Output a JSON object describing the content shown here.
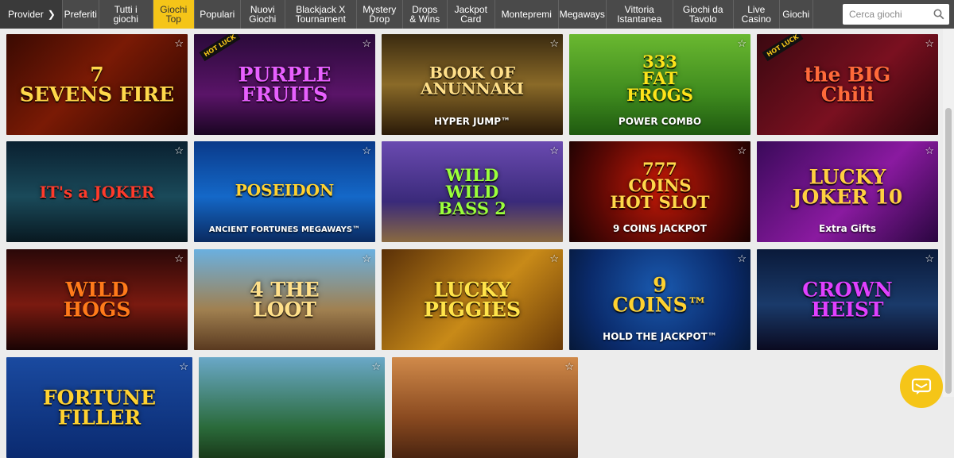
{
  "nav": {
    "provider": "Provider",
    "items": [
      {
        "label": "Preferiti"
      },
      {
        "label": "Tutti i\ngiochi"
      },
      {
        "label": "Giochi\nTop"
      },
      {
        "label": "Populari"
      },
      {
        "label": "Nuovi\nGiochi"
      },
      {
        "label": "Blackjack X\nTournament"
      },
      {
        "label": "Mystery\nDrop"
      },
      {
        "label": "Drops\n& Wins"
      },
      {
        "label": "Jackpot\nCard"
      },
      {
        "label": "Montepremi"
      },
      {
        "label": "Megaways"
      },
      {
        "label": "Vittoria\nIstantanea"
      },
      {
        "label": "Giochi da\nTavolo"
      },
      {
        "label": "Live\nCasino"
      },
      {
        "label": "Giochi"
      }
    ],
    "active_index": 2,
    "search_placeholder": "Cerca giochi"
  },
  "games": [
    {
      "title": "7\nSEVENS FIRE",
      "subtitle": "",
      "badge": "",
      "bg": "linear-gradient(135deg,#3a0a02,#7a1a05 45%,#2a0500)",
      "color": "#ffd84a"
    },
    {
      "title": "PURPLE\nFRUITS",
      "subtitle": "",
      "badge": "HOT LUCK",
      "bg": "linear-gradient(180deg,#2a0a3a,#5a1468 60%,#1a0522)",
      "color": "#e860ff"
    },
    {
      "title": "BOOK OF ANUNNAKI",
      "subtitle": "HYPER JUMP™",
      "badge": "",
      "bg": "linear-gradient(180deg,#3a2a10,#8a6a28 50%,#2a1a08)",
      "color": "#ffe08a"
    },
    {
      "title": "333\nFAT\nFROGS",
      "subtitle": "POWER COMBO",
      "badge": "",
      "bg": "linear-gradient(180deg,#6ab830,#3e8a1e 60%,#1f5a10)",
      "color": "#ffe31a"
    },
    {
      "title": "the BIG\nChili",
      "subtitle": "",
      "badge": "HOT LUCK",
      "bg": "linear-gradient(135deg,#3a0810,#7a1020 55%,#2a0408)",
      "color": "#ff6a3a"
    },
    {
      "title": "IT's a JOKER",
      "subtitle": "",
      "badge": "",
      "bg": "linear-gradient(180deg,#0a2030,#1a4a5a 55%,#081820)",
      "color": "#ff3a2a"
    },
    {
      "title": "POSEIDON",
      "subtitle": "ANCIENT FORTUNES MEGAWAYS™",
      "badge": "",
      "bg": "linear-gradient(180deg,#0a3a8a,#1468c8 55%,#0a2a60)",
      "color": "#ffd230"
    },
    {
      "title": "WILD\nWILD\nBASS 2",
      "subtitle": "",
      "badge": "",
      "bg": "linear-gradient(180deg,#6a4ab0,#3a2a7a 60%,#8a6a40)",
      "color": "#9aff3a"
    },
    {
      "title": "777\nCOINS\nHOT SLOT",
      "subtitle": "9 COINS JACKPOT",
      "badge": "",
      "bg": "radial-gradient(circle at 50% 45%,#c81a08,#5a0804 60%,#1a0202)",
      "color": "#ffd84a"
    },
    {
      "title": "LUCKY\nJOKER 10",
      "subtitle": "Extra Gifts",
      "badge": "",
      "bg": "linear-gradient(135deg,#3a0a5a,#8a1aa0 55%,#2a0640)",
      "color": "#ffd040"
    },
    {
      "title": "WILD\nHOGS",
      "subtitle": "",
      "badge": "",
      "bg": "linear-gradient(180deg,#2a0808,#7a1a10 55%,#1a0404)",
      "color": "#ff7a1a"
    },
    {
      "title": "4 THE\nLOOT",
      "subtitle": "",
      "badge": "",
      "bg": "linear-gradient(180deg,#6ab0e0,#a08050 60%,#5a3a20)",
      "color": "#ffe08a"
    },
    {
      "title": "LUCKY\nPIGGIES",
      "subtitle": "",
      "badge": "",
      "bg": "linear-gradient(135deg,#5a3008,#c88a18 55%,#6a3a08)",
      "color": "#ffe44a"
    },
    {
      "title": "9\nCOINS™",
      "subtitle": "HOLD THE JACKPOT™",
      "badge": "",
      "bg": "radial-gradient(circle at 50% 40%,#1a5ab0,#0a2a6a 65%,#061838)",
      "color": "#ffd230"
    },
    {
      "title": "CROWN\nHEIST",
      "subtitle": "",
      "badge": "",
      "bg": "linear-gradient(180deg,#0a1a3a,#1a3a6a 55%,#0a0a20)",
      "color": "#e040ff"
    },
    {
      "title": "FORTUNE\nFILLER",
      "subtitle": "",
      "badge": "",
      "bg": "linear-gradient(180deg,#1a4aa0,#0a2a70)",
      "color": "#ffd230"
    },
    {
      "title": "",
      "subtitle": "",
      "badge": "",
      "bg": "linear-gradient(180deg,#6aa8c8,#2a6a3a 70%,#1a3a1a)",
      "color": "#fff"
    },
    {
      "title": "",
      "subtitle": "",
      "badge": "",
      "bg": "linear-gradient(180deg,#d08a4a,#8a4a20 60%,#4a2410)",
      "color": "#fff"
    }
  ],
  "icons": {
    "star": "star-outline-icon",
    "search": "search-icon",
    "chat": "chat-icon",
    "chevron": "chevron-right-icon"
  },
  "colors": {
    "nav_bg": "#4a4a4a",
    "active_tab": "#f5c518",
    "page_bg": "#ececec"
  }
}
